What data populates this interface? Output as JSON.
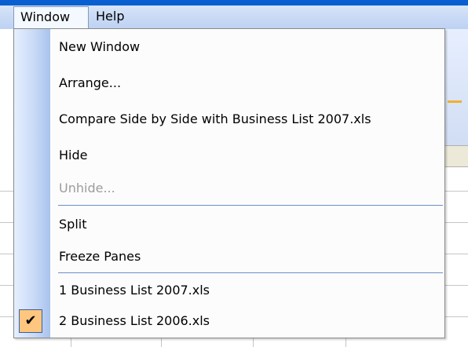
{
  "menubar": {
    "window_label": "Window",
    "help_label": "Help"
  },
  "window_menu": {
    "items": [
      {
        "label": "New Window",
        "enabled": true
      },
      {
        "label": "Arrange...",
        "enabled": true
      },
      {
        "label": "Compare Side by Side with Business List 2007.xls",
        "enabled": true
      },
      {
        "label": "Hide",
        "enabled": true
      },
      {
        "label": "Unhide...",
        "enabled": false
      },
      {
        "label": "Split",
        "enabled": true
      },
      {
        "label": "Freeze Panes",
        "enabled": true
      },
      {
        "label": "1 Business List 2007.xls",
        "enabled": true
      },
      {
        "label": "2 Business List 2006.xls",
        "enabled": true,
        "checked": true
      }
    ],
    "check_glyph": "✔"
  },
  "colors": {
    "gutter": "#c9daf6",
    "checked_background": "#ffc680",
    "separator": "#6a8fc6",
    "disabled_text": "#9c9c9c"
  },
  "icons": [
    "checkmark-icon"
  ]
}
